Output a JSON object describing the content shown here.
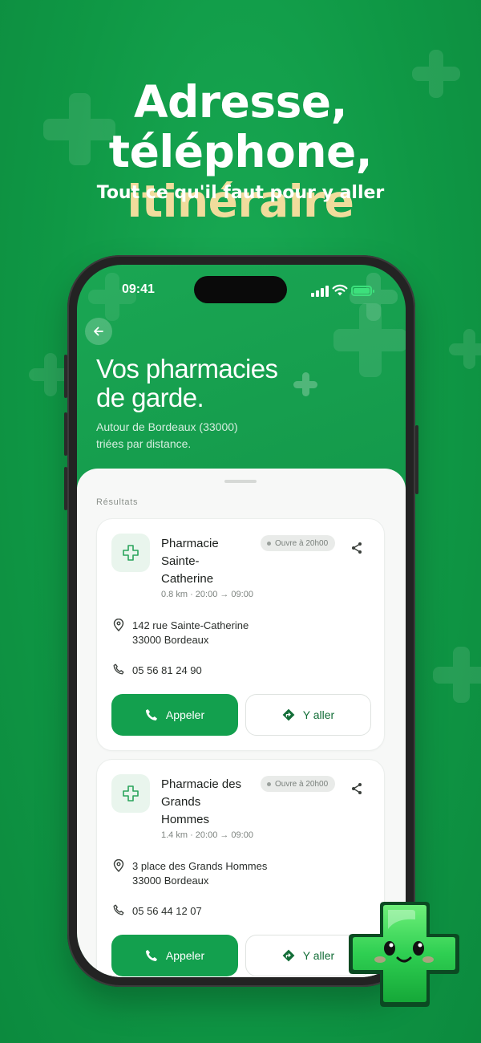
{
  "promo": {
    "headline_line1": "Adresse, téléphone,",
    "headline_accent": "itinéraire",
    "subtitle": "Tout ce qu'il faut pour y aller",
    "accent_color": "#f0dc9c",
    "background_color": "#119a48"
  },
  "status_bar": {
    "time": "09:41",
    "icons": [
      "signal-icon",
      "wifi-icon",
      "battery-charging-icon"
    ]
  },
  "header": {
    "back_icon": "arrow-left-icon",
    "title_line1": "Vos pharmacies",
    "title_line2": "de garde.",
    "subtitle_line1": "Autour de Bordeaux (33000)",
    "subtitle_line2": "triées par distance."
  },
  "results": {
    "label": "Résultats",
    "items": [
      {
        "name": "Pharmacie Sainte-Catherine",
        "name_lines": [
          "Pharmacie",
          "Sainte-",
          "Catherine"
        ],
        "meta": "0.8 km · 20:00 → 09:00",
        "badge": "Ouvre à 20h00",
        "address_line1": "142 rue Sainte-Catherine",
        "address_line2": "33000 Bordeaux",
        "phone": "05 56 81 24 90",
        "call_label": "Appeler",
        "directions_label": "Y aller"
      },
      {
        "name": "Pharmacie des Grands Hommes",
        "name_lines": [
          "Pharmacie des",
          "Grands",
          "Hommes"
        ],
        "meta": "1.4 km · 20:00 → 09:00",
        "badge": "Ouvre à 20h00",
        "address_line1": "3 place des Grands Hommes",
        "address_line2": "33000 Bordeaux",
        "phone": "05 56 44 12 07",
        "call_label": "Appeler",
        "directions_label": "Y aller"
      }
    ]
  },
  "colors": {
    "primary_green": "#13a04e",
    "sheet_bg": "#f7f8f7",
    "badge_bg": "#e9ebe9"
  }
}
